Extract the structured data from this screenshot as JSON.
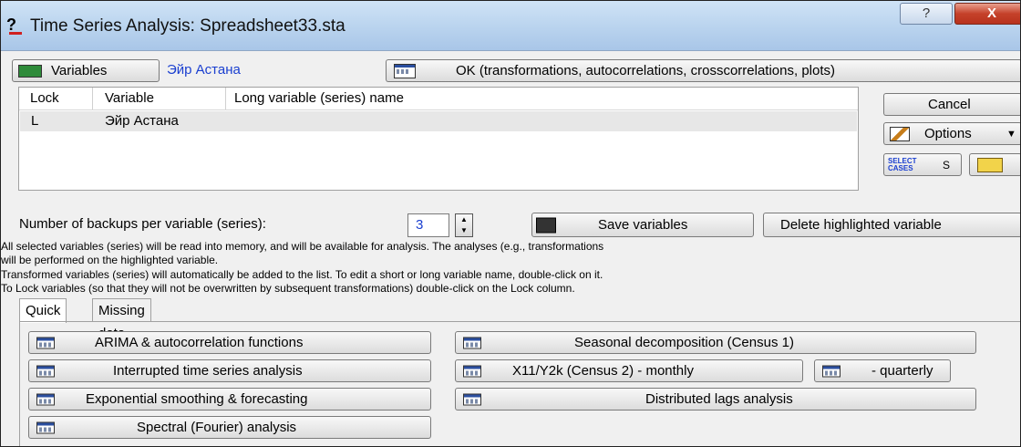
{
  "window": {
    "title": "Time Series Analysis: Spreadsheet33.sta",
    "title_icon_text": "?",
    "help_label": "?",
    "close_label": "X"
  },
  "top": {
    "variables_label": "Variables",
    "variables_mnemonic": "V",
    "selected_variable": "Эйр Астана",
    "ok_label": "OK (transformations, autocorrelations, crosscorrelations, plots)"
  },
  "table": {
    "columns": [
      "Lock",
      "Variable",
      "Long variable (series) name"
    ],
    "rows": [
      {
        "lock": "L",
        "variable": "Эйр Астана",
        "long_name": ""
      }
    ]
  },
  "side": {
    "cancel_label": "Cancel",
    "options_label": "Options",
    "select_cases_line1": "SELECT",
    "select_cases_line2": "CASES",
    "select_cases_suffix": "S"
  },
  "backups": {
    "label": "Number of backups per variable (series):",
    "value": "3",
    "save_label": "Save variables",
    "delete_label": "Delete highlighted variable"
  },
  "info_lines": [
    "All selected variables (series) will be read into memory, and will be available for analysis. The analyses (e.g., transformations",
    "will be performed on the highlighted variable.",
    "Transformed variables (series) will automatically be added to the list. To edit a short or long variable name, double-click on it.",
    "To Lock variables (so that they will not be overwritten by subsequent transformations) double-click on the Lock column."
  ],
  "tabs": {
    "quick": "Quick",
    "missing": "Missing data"
  },
  "quick_buttons": {
    "arima": "ARIMA & autocorrelation functions",
    "interrupted": "Interrupted time series analysis",
    "exponential": "Exponential smoothing & forecasting",
    "spectral": "Spectral (Fourier) analysis",
    "seasonal": "Seasonal decomposition (Census 1)",
    "x11": "X11/Y2k (Census 2) - monthly",
    "quarterly": "- quarterly",
    "distributed": "Distributed lags analysis"
  }
}
